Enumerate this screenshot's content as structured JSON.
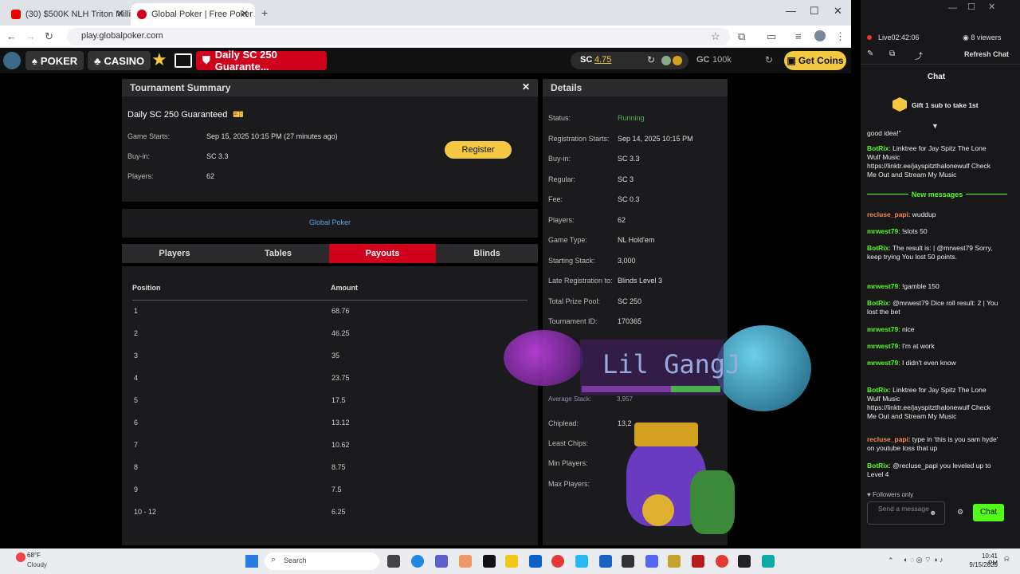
{
  "browser": {
    "tabs": [
      {
        "title": "(30) $500K NLH Triton Milli…",
        "active": false
      },
      {
        "title": "Global Poker | Free Poker At Its…",
        "active": true
      }
    ],
    "url": "play.globalpoker.com"
  },
  "site": {
    "nav_poker": "POKER",
    "nav_casino": "CASINO",
    "tourney_tab": "Daily SC 250 Guarante...",
    "sc_label": "SC",
    "sc_value": "4.75",
    "gc_label": "GC",
    "gc_value": "100k",
    "get_coins": "Get Coins"
  },
  "summary": {
    "header": "Tournament Summary",
    "name": "Daily SC 250 Guaranteed",
    "game_starts_label": "Game Starts:",
    "game_starts_value": "Sep 15, 2025 10:15 PM (27 minutes ago)",
    "buyin_label": "Buy-in:",
    "buyin_value": "SC 3.3",
    "players_label": "Players:",
    "players_value": "62",
    "register": "Register",
    "brand": "Global Poker"
  },
  "tabs": [
    "Players",
    "Tables",
    "Payouts",
    "Blinds"
  ],
  "payouts": {
    "col_position": "Position",
    "col_amount": "Amount",
    "rows": [
      {
        "pos": "1",
        "amt": "68.76"
      },
      {
        "pos": "2",
        "amt": "46.25"
      },
      {
        "pos": "3",
        "amt": "35"
      },
      {
        "pos": "4",
        "amt": "23.75"
      },
      {
        "pos": "5",
        "amt": "17.5"
      },
      {
        "pos": "6",
        "amt": "13.12"
      },
      {
        "pos": "7",
        "amt": "10.62"
      },
      {
        "pos": "8",
        "amt": "8.75"
      },
      {
        "pos": "9",
        "amt": "7.5"
      },
      {
        "pos": "10 - 12",
        "amt": "6.25"
      }
    ]
  },
  "details": {
    "header": "Details",
    "rows": [
      {
        "label": "Status:",
        "value": "Running"
      },
      {
        "label": "Registration Starts:",
        "value": "Sep 14, 2025 10:15 PM"
      },
      {
        "label": "Buy-in:",
        "value": "SC 3.3"
      },
      {
        "label": "Regular:",
        "value": "SC 3"
      },
      {
        "label": "Fee:",
        "value": "SC 0.3"
      },
      {
        "label": "Players:",
        "value": "62"
      },
      {
        "label": "Game Type:",
        "value": "NL Hold'em"
      },
      {
        "label": "Starting Stack:",
        "value": "3,000"
      },
      {
        "label": "Late Registration to:",
        "value": "Blinds Level 3"
      },
      {
        "label": "Total Prize Pool:",
        "value": "SC 250"
      },
      {
        "label": "Tournament ID:",
        "value": "170365"
      }
    ],
    "chipleader_label": "Chiplead:",
    "chipleader_value": "13,2",
    "avg_stack_label": "Average Stack:",
    "avg_stack_value": "3,957",
    "least_chips_label": "Least Chips:",
    "min_players_label": "Min Players:",
    "max_players_label": "Max Players:"
  },
  "overlay": {
    "title": "Lil GangJ"
  },
  "chat": {
    "live": "Live",
    "time": "02:42:06",
    "viewers": "8 viewers",
    "refresh": "Refresh Chat",
    "heading": "Chat",
    "gift": "Gift 1 sub to take 1st",
    "new_messages": "New messages",
    "followers": "Followers only",
    "send_placeholder": "Send a message",
    "chat_btn": "Chat",
    "messages": [
      {
        "name": "",
        "text": "good idea!\""
      },
      {
        "name": "BotRix",
        "text": ": Linktree for Jay Spitz The Lone Wulf Music https://linktr.ee/jayspitzthalonewulf Check Me Out and Stream My Music"
      },
      {
        "name": "recluse_papi",
        "text": ": wuddup"
      },
      {
        "name": "mrwest79",
        "text": ": !slots 50"
      },
      {
        "name": "BotRix",
        "text": ": The result is: | @mrwest79 Sorry, keep trying You lost 50 points."
      },
      {
        "name": "mrwest79",
        "text": ": !gamble 150"
      },
      {
        "name": "BotRix",
        "text": ": @mrwest79 Dice roll result: 2 | You lost the bet"
      },
      {
        "name": "mrwest79",
        "text": ": nice"
      },
      {
        "name": "mrwest79",
        "text": ": I'm at work"
      },
      {
        "name": "mrwest79",
        "text": ": I didn't even know"
      },
      {
        "name": "BotRix",
        "text": ": Linktree for Jay Spitz The Lone Wulf Music https://linktr.ee/jayspitzthalonewulf Check Me Out and Stream My Music"
      },
      {
        "name": "recluse_papi",
        "text": ": type in 'this is you sam hyde' on youtube toss that up"
      },
      {
        "name": "BotRix",
        "text": ": @recluse_papi you leveled up to Level 4"
      }
    ]
  },
  "taskbar": {
    "weather_temp": "68°F",
    "weather_desc": "Cloudy",
    "search": "Search",
    "time": "10:41 PM",
    "date": "9/15/2025"
  },
  "colors": {
    "accent_red": "#d0021b",
    "gold": "#f5c842",
    "status_green": "#4caf50",
    "twitch_green": "#53fc18"
  }
}
